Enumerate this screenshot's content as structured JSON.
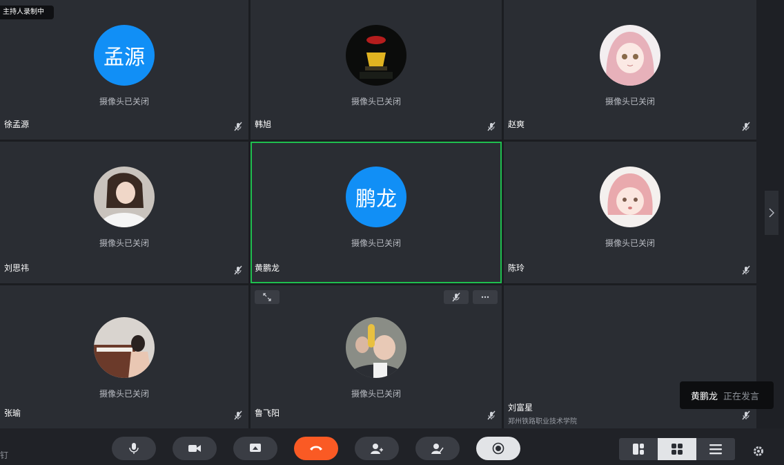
{
  "recording_badge": "主持人录制中",
  "cam_off_text": "摄像头已关闭",
  "participants": [
    {
      "name": "徐孟源",
      "avatar_text": "孟源"
    },
    {
      "name": "韩旭"
    },
    {
      "name": "赵爽"
    },
    {
      "name": "刘思祎"
    },
    {
      "name": "黄鹏龙",
      "avatar_text": "鹏龙"
    },
    {
      "name": "陈玲"
    },
    {
      "name": "张瑜"
    },
    {
      "name": "鲁飞阳"
    },
    {
      "name": "刘富星",
      "org": "郑州铁路职业技术学院"
    }
  ],
  "speaking": {
    "name": "黄鹏龙",
    "status": "正在发言"
  },
  "toolbar": {
    "pin_label": "钉"
  },
  "colors": {
    "accent": "#118ff6",
    "active_border": "#1fbf4f",
    "hangup": "#fa5a24"
  }
}
